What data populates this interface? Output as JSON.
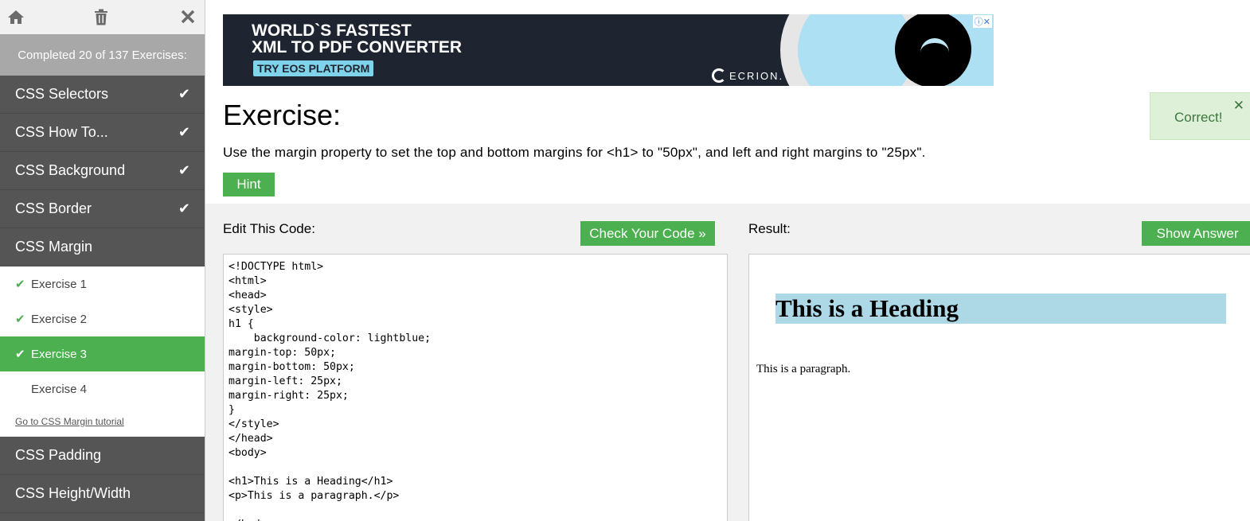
{
  "sidebar": {
    "icons": [
      "home-icon",
      "trash-icon",
      "close-icon"
    ],
    "progress": "Completed 20 of 137 Exercises:",
    "topics_before": [
      {
        "label": "CSS Selectors",
        "done": true
      },
      {
        "label": "CSS How To...",
        "done": true
      },
      {
        "label": "CSS Background",
        "done": true
      },
      {
        "label": "CSS Border",
        "done": true
      }
    ],
    "active_topic": "CSS Margin",
    "exercises": [
      {
        "label": "Exercise 1",
        "done": true
      },
      {
        "label": "Exercise 2",
        "done": true
      },
      {
        "label": "Exercise 3",
        "done": true,
        "selected": true
      },
      {
        "label": "Exercise 4",
        "done": false
      }
    ],
    "tutorial_link": "Go to CSS Margin tutorial",
    "topics_after": [
      {
        "label": "CSS Padding"
      },
      {
        "label": "CSS Height/Width"
      }
    ]
  },
  "ad": {
    "line1": "WORLD`S FASTEST",
    "line2": "XML TO PDF CONVERTER",
    "cta": "TRY EOS PLATFORM",
    "brand": "ECRION."
  },
  "exercise": {
    "title": "Exercise:",
    "instruction": "Use the margin property to set the top and bottom margins for <h1> to \"50px\", and left and right margins to \"25px\".",
    "hint_label": "Hint"
  },
  "toast": {
    "text": "Correct!"
  },
  "workspace": {
    "edit_label": "Edit This Code:",
    "check_label": "Check Your Code »",
    "result_label": "Result:",
    "show_label": "Show Answer",
    "code": "<!DOCTYPE html>\n<html>\n<head>\n<style>\nh1 {\n    background-color: lightblue;\nmargin-top: 50px;\nmargin-bottom: 50px;\nmargin-left: 25px;\nmargin-right: 25px;\n}\n</style>\n</head>\n<body>\n\n<h1>This is a Heading</h1>\n<p>This is a paragraph.</p>\n\n</body>",
    "result_heading": "This is a Heading",
    "result_paragraph": "This is a paragraph."
  },
  "colors": {
    "accent": "#4caf50",
    "sidebar_bg": "#555555",
    "result_heading_bg": "lightblue"
  }
}
